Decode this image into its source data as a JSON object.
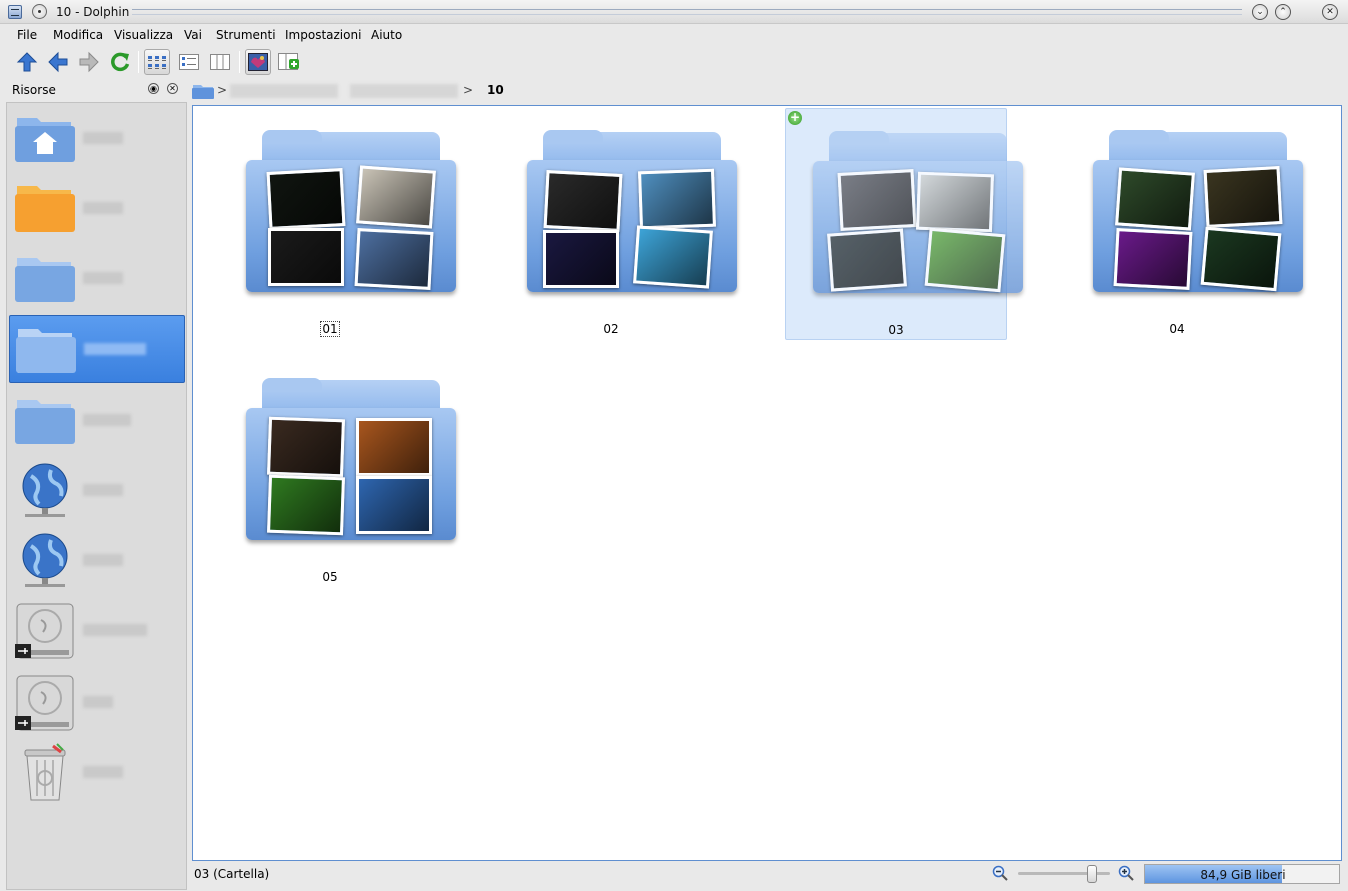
{
  "window": {
    "title": "10 - Dolphin"
  },
  "menu": [
    "File",
    "Modifica",
    "Visualizza",
    "Vai",
    "Strumenti",
    "Impostazioni",
    "Aiuto"
  ],
  "toolbar": {
    "buttons": [
      {
        "name": "up",
        "icon": "arrow-up-icon"
      },
      {
        "name": "back",
        "icon": "arrow-left-icon"
      },
      {
        "name": "forward",
        "icon": "arrow-right-icon"
      },
      {
        "name": "reload",
        "icon": "reload-icon"
      },
      {
        "name": "icons-view",
        "icon": "icons-view-icon",
        "selected": true
      },
      {
        "name": "details-view",
        "icon": "details-view-icon"
      },
      {
        "name": "columns-view",
        "icon": "columns-view-icon"
      },
      {
        "name": "preview",
        "icon": "preview-icon",
        "selected": true
      },
      {
        "name": "split",
        "icon": "split-view-icon"
      }
    ]
  },
  "sidebar": {
    "title": "Risorse",
    "items": [
      {
        "icon": "home-folder-icon",
        "label": "",
        "selected": false
      },
      {
        "icon": "orange-folder-icon",
        "label": "",
        "selected": false
      },
      {
        "icon": "folder-icon",
        "label": "",
        "selected": false
      },
      {
        "icon": "folder-icon",
        "label": "",
        "selected": true
      },
      {
        "icon": "folder-icon",
        "label": "",
        "selected": false
      },
      {
        "icon": "network-globe-icon",
        "label": "",
        "selected": false
      },
      {
        "icon": "network-globe-icon",
        "label": "",
        "selected": false
      },
      {
        "icon": "hard-drive-icon",
        "label": "",
        "selected": false
      },
      {
        "icon": "hard-drive-icon",
        "label": "",
        "selected": false
      },
      {
        "icon": "trash-icon",
        "label": "",
        "selected": false
      }
    ]
  },
  "location": {
    "current": "10"
  },
  "items": [
    {
      "name": "01",
      "focused": true,
      "hovered": false,
      "thumbs": [
        "#101510",
        "#c9c3b6",
        "#1b1b1b",
        "#4d6fa0"
      ]
    },
    {
      "name": "02",
      "focused": false,
      "hovered": false,
      "thumbs": [
        "#2a2a2a",
        "#4f8fbf",
        "#1a1840",
        "#3da4d8"
      ]
    },
    {
      "name": "03",
      "focused": false,
      "hovered": true,
      "thumbs": [
        "#5a5a60",
        "#d0d2d0",
        "#2a3438",
        "#58a83a"
      ]
    },
    {
      "name": "04",
      "focused": false,
      "hovered": false,
      "thumbs": [
        "#2e4a2a",
        "#3a3520",
        "#6a1a8a",
        "#1b3820"
      ]
    },
    {
      "name": "05",
      "focused": false,
      "hovered": false,
      "thumbs": [
        "#3a2a20",
        "#a8561e",
        "#2f7a20",
        "#2e66b0"
      ]
    }
  ],
  "status": {
    "message": "03 (Cartella)",
    "zoom_level": 0.85,
    "free_space": "84,9 GiB liberi",
    "used_fraction": 0.7
  }
}
